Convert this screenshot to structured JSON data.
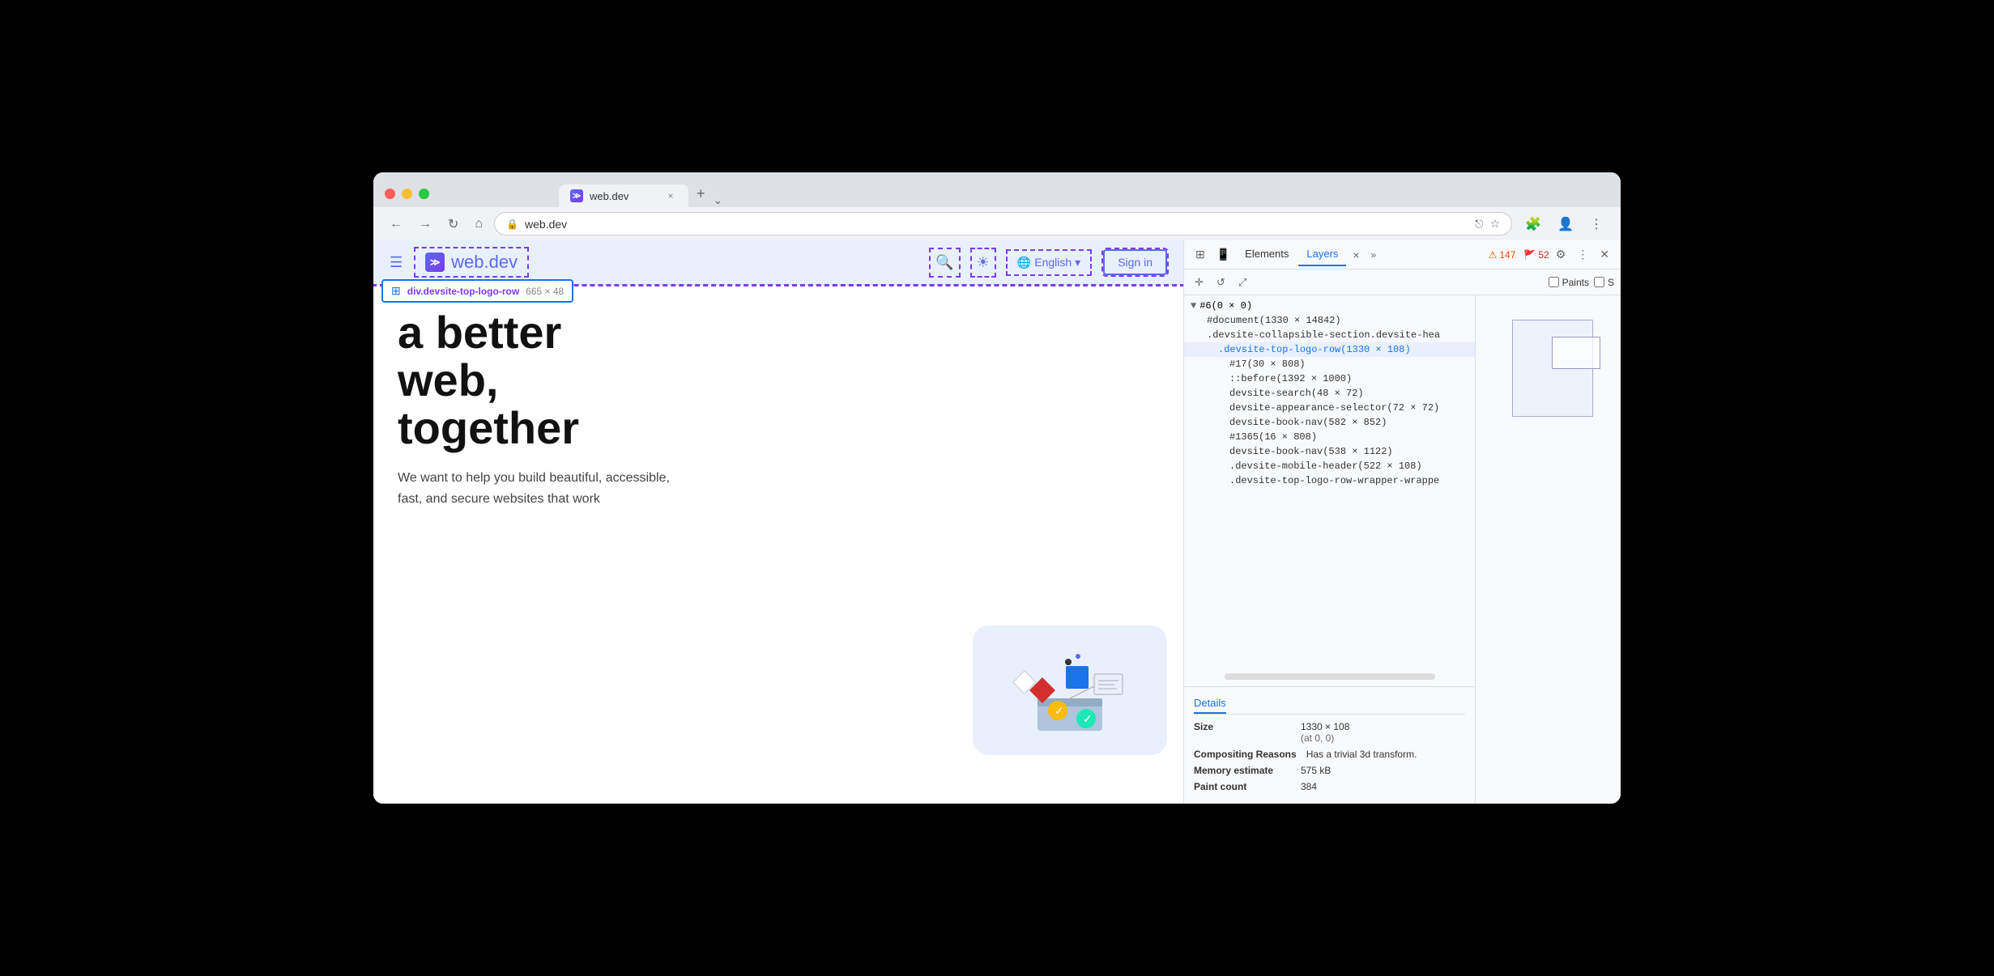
{
  "browser": {
    "tab": {
      "favicon": "≫",
      "title": "web.dev",
      "close": "×"
    },
    "new_tab": "+",
    "nav": {
      "back": "←",
      "forward": "→",
      "refresh": "↻",
      "home": "⌂",
      "address": "web.dev",
      "address_icon": "🔒",
      "ext_link": "⎋",
      "bookmark": "☆",
      "extensions": "🧩",
      "profile": "👤",
      "more": "⋮",
      "dropdown": "⌄"
    }
  },
  "webpage": {
    "header": {
      "menu_icon": "☰",
      "logo_icon": "≫",
      "logo_text": "web.dev",
      "search_icon": "🔍",
      "theme_icon": "☀",
      "globe_icon": "🌐",
      "lang": "English",
      "lang_arrow": "▾",
      "signin": "Sign in"
    },
    "tooltip": {
      "icon": "⊞",
      "element": "div.devsite-top-logo-row",
      "size": "665 × 48"
    },
    "content": {
      "heading_line1": "a better",
      "heading_line2": "web,",
      "heading_line3": "together",
      "subtext": "We want to help you build beautiful, accessible, fast, and secure websites that work"
    }
  },
  "devtools": {
    "toolbar": {
      "inspector_icon": "⊞",
      "device_icon": "📱",
      "elements_tab": "Elements",
      "layers_tab": "Layers",
      "layers_close": "×",
      "more_tabs": "»",
      "warn_icon": "⚠",
      "warn_count": "147",
      "error_icon": "🚩",
      "error_count": "52",
      "gear_icon": "⚙",
      "more_icon": "⋮",
      "close_icon": "✕"
    },
    "layers_toolbar": {
      "pan_icon": "✛",
      "rotate_icon": "↺",
      "resize_icon": "⤢",
      "paints_label": "Paints",
      "slowscroll_label": "S"
    },
    "tree": {
      "root": "#6(0 × 0)",
      "items": [
        {
          "text": "#document(1330 × 14842)",
          "indent": 1,
          "selected": false
        },
        {
          "text": ".devsite-collapsible-section.devsite-hea",
          "indent": 1,
          "selected": false
        },
        {
          "text": ".devsite-top-logo-row(1330 × 108)",
          "indent": 2,
          "selected": true
        },
        {
          "text": "#17(30 × 808)",
          "indent": 3,
          "selected": false
        },
        {
          "text": "::before(1392 × 1000)",
          "indent": 3,
          "selected": false
        },
        {
          "text": "devsite-search(48 × 72)",
          "indent": 3,
          "selected": false
        },
        {
          "text": "devsite-appearance-selector(72 × 72)",
          "indent": 3,
          "selected": false
        },
        {
          "text": "devsite-book-nav(582 × 852)",
          "indent": 3,
          "selected": false
        },
        {
          "text": "#1365(16 × 808)",
          "indent": 3,
          "selected": false
        },
        {
          "text": "devsite-book-nav(538 × 1122)",
          "indent": 3,
          "selected": false
        },
        {
          "text": ".devsite-mobile-header(522 × 108)",
          "indent": 3,
          "selected": false
        },
        {
          "text": ".devsite-top-logo-row-wrapper-wrappe",
          "indent": 3,
          "selected": false
        }
      ]
    },
    "details": {
      "tab": "Details",
      "size_label": "Size",
      "size_value": "1330 × 108",
      "size_extra": "(at 0, 0)",
      "compositing_label": "Compositing Reasons",
      "compositing_value": "Has a trivial 3d transform.",
      "memory_label": "Memory estimate",
      "memory_value": "575 kB",
      "paint_count_label": "Paint count",
      "paint_count_value": "384"
    }
  }
}
